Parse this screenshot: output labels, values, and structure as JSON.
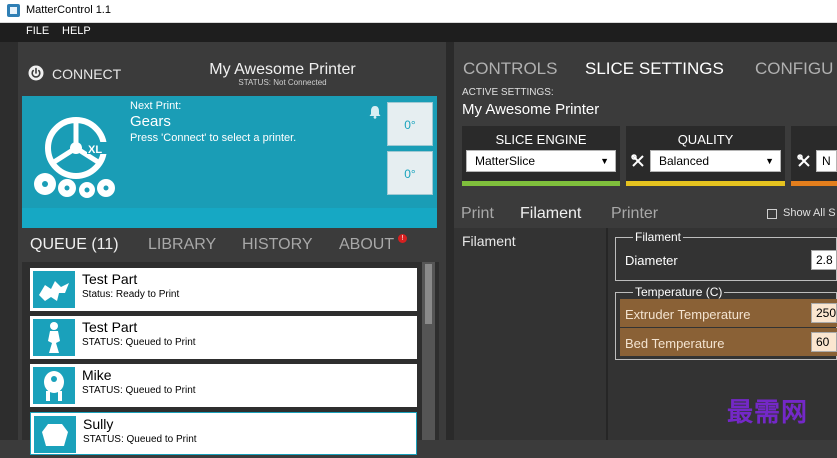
{
  "window": {
    "title": "MatterControl 1.1"
  },
  "menu": {
    "items": [
      "FILE",
      "HELP"
    ]
  },
  "printer": {
    "connect_label": "CONNECT",
    "name": "My Awesome Printer",
    "status": "STATUS: Not Connected"
  },
  "print_panel": {
    "next_print_label": "Next Print:",
    "next_print_title": "Gears",
    "hint": "Press 'Connect' to select a printer.",
    "extruder_temp": "0°",
    "bed_temp": "0°"
  },
  "left_tabs": [
    "QUEUE (11)",
    "LIBRARY",
    "HISTORY",
    "ABOUT"
  ],
  "about_badge": "!",
  "queue": [
    {
      "name": "Test Part",
      "status": "Status: Ready to Print"
    },
    {
      "name": "Test Part",
      "status": "STATUS: Queued to Print"
    },
    {
      "name": "Mike",
      "status": "STATUS: Queued to Print"
    },
    {
      "name": "Sully",
      "status": "STATUS: Queued to Print"
    }
  ],
  "right_tabs": [
    "CONTROLS",
    "SLICE SETTINGS",
    "CONFIGU"
  ],
  "active_settings": {
    "label": "ACTIVE SETTINGS:",
    "value": "My Awesome Printer"
  },
  "slice_engine": {
    "title": "SLICE ENGINE",
    "value": "MatterSlice"
  },
  "quality": {
    "title": "QUALITY",
    "value": "Balanced"
  },
  "material": {
    "value": "N"
  },
  "sub_tabs": [
    "Print",
    "Filament",
    "Printer"
  ],
  "show_all_label": "Show All S",
  "category_label": "Filament",
  "filament_group": {
    "legend": "Filament",
    "diameter_label": "Diameter",
    "diameter_value": "2.8"
  },
  "temperature_group": {
    "legend": "Temperature (C)",
    "extruder_label": "Extruder Temperature",
    "extruder_value": "250",
    "bed_label": "Bed Temperature",
    "bed_value": "60"
  },
  "watermark": "最需网",
  "colors": {
    "accent": "#1a9db6",
    "green_bar": "#7fbf3c",
    "yellow_bar": "#e5c21f",
    "orange_bar": "#e37e1d",
    "highlight_row": "#8a6136"
  }
}
